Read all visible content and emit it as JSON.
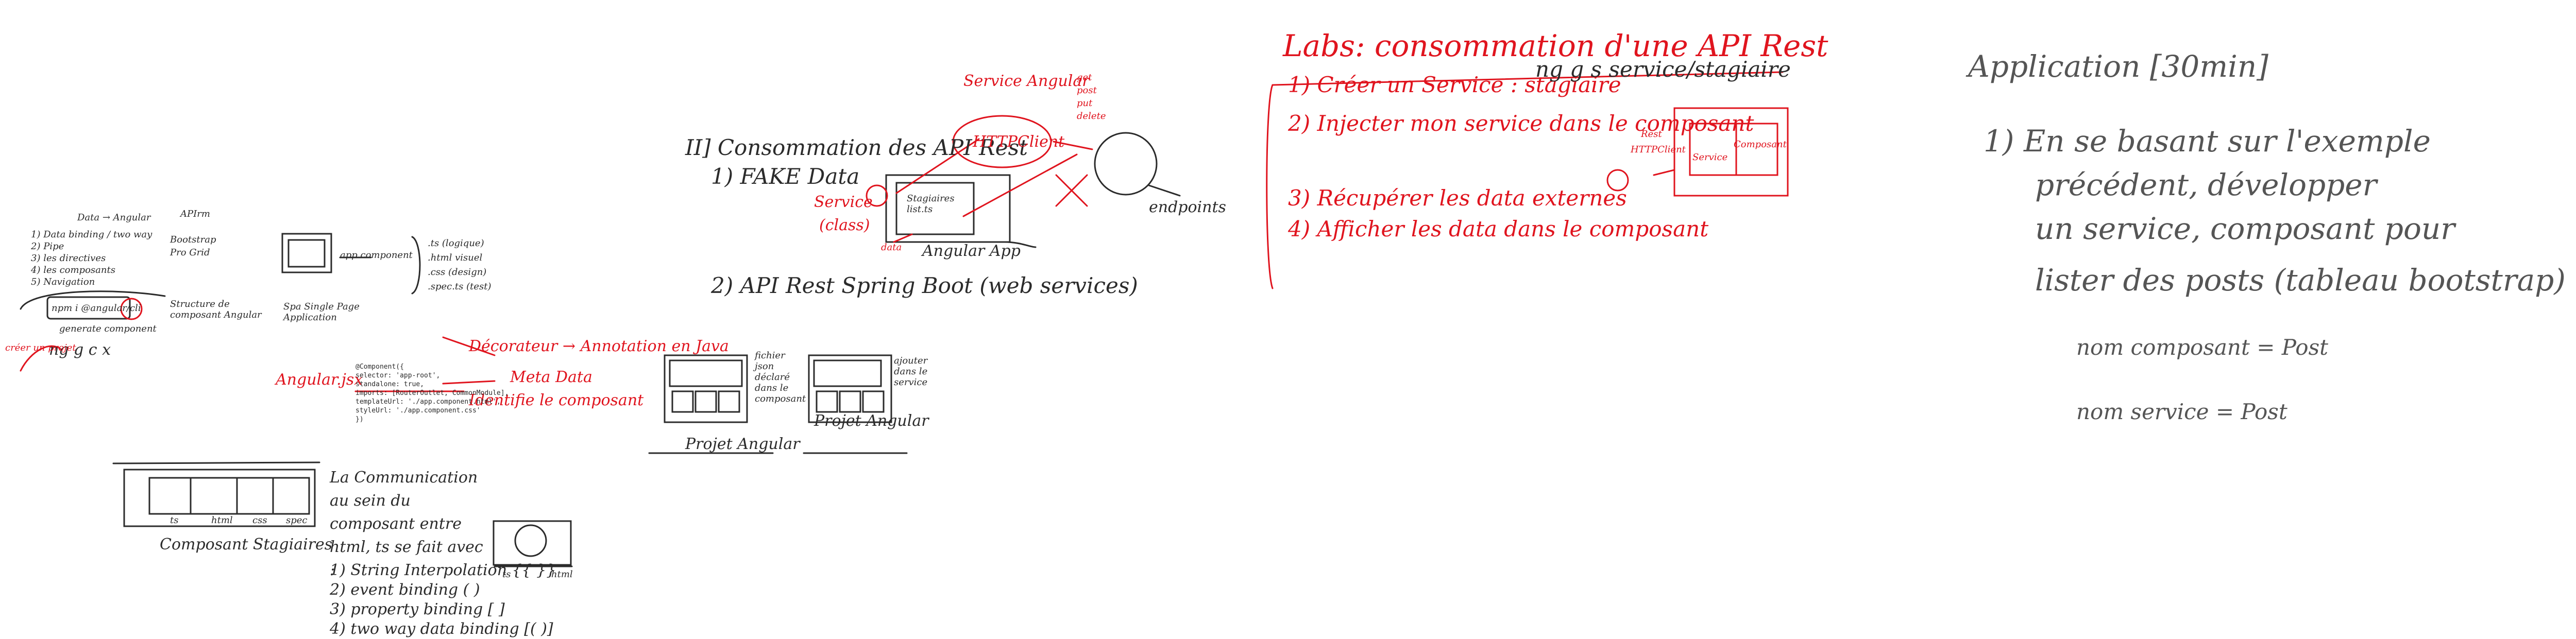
{
  "section_angular": {
    "heading_1": "Data → Angular",
    "heading_2": "APIrm",
    "checklist": [
      "1) Data binding / two way",
      "2) Pipe",
      "3) les directives",
      "4) les composants",
      "5) Navigation"
    ],
    "bootstrap_labels": [
      "Bootstrap",
      "Pro Grid"
    ],
    "npm_box": "npm i @angular/cli",
    "generate_component": "generate component",
    "ng_gc": "ng g c x",
    "create_hint": "créer un projet",
    "structure_label": "Structure de composant Angular",
    "spa_label": "Spa Single Page Application",
    "app_component": "app component",
    "file_list": [
      ".ts (logique)",
      ".html visuel",
      ".css (design)",
      ".spec.ts (test)"
    ],
    "angular_jsx": "Angular.jsx",
    "decorator": "Décorateur → Annotation en Java",
    "meta_data": "Meta Data",
    "identifier": "Identifie le composant",
    "code_lines": [
      "@Component({",
      "selector: 'app-root',",
      "standalone: true,",
      "imports: [RouterOutlet, CommonModule],",
      "templateUrl: './app.component.html',",
      "styleUrl: './app.component.css'",
      "})"
    ],
    "composant_stagiaires": "Composant Stagiaires",
    "strip_labels": [
      "ts",
      "html",
      "css",
      "spec"
    ],
    "communication_title": "La Communication au sein du composant entre html, ts se fait avec :",
    "bindings": [
      "1) String Interpolation {{ }}",
      "2) event binding ( )",
      "3) property binding [ ]",
      "4) two way data binding [( )]"
    ],
    "mini_labels": [
      "ts",
      "html"
    ]
  },
  "section_api": {
    "title": "II] Consommation des API Rest",
    "item_1": "1) FAKE Data",
    "item_2": "2) API Rest Spring Boot (web services)",
    "service_angular": "Service Angular",
    "http_client": "HTTPClient",
    "methods": [
      "get",
      "post",
      "put",
      "delete"
    ],
    "service_label": "Service",
    "class_label": "(class)",
    "stagiaires_box": "Stagiaires list.ts",
    "data_label": "data",
    "angular_app": "Angular App",
    "endpoints": "endpoints",
    "projet_a": "Projet Angular",
    "projet_b": "Projet Angular",
    "fichier_note": "fichier json déclaré dans le composant",
    "ajout_note": "ajouter dans le service"
  },
  "section_labs": {
    "title": "Labs: consommation d'une API Rest",
    "steps": [
      "1) Créer un Service : stagiaire",
      "2) Injecter mon service dans le composant",
      "3) Récupérer les data externes",
      "4) Afficher les data dans le composant"
    ],
    "ng_cmd": "ng g s service/stagiaire",
    "rest_label": "Rest",
    "http_label": "HTTPClient",
    "service_box": "Service",
    "composant_box": "Composant"
  },
  "section_application": {
    "title": "Application [30min]",
    "instruction": [
      "1) En se basant sur l'exemple",
      "précédent, développer",
      "un service, composant pour",
      "lister des posts (tableau bootstrap)"
    ],
    "component_name": "nom composant = Post",
    "service_name": "nom service = Post"
  },
  "colors": {
    "ink": "#2b2b2b",
    "red": "#e0141e",
    "background": "#ffffff"
  }
}
